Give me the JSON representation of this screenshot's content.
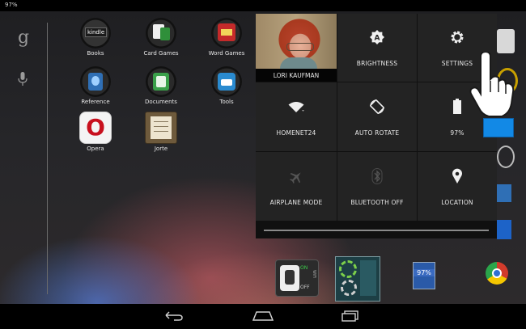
{
  "status_bar": {
    "battery": "97%"
  },
  "home": {
    "apps": [
      {
        "label": "Books",
        "icon": "books-icon"
      },
      {
        "label": "Card Games",
        "icon": "card-games-icon"
      },
      {
        "label": "Word Games",
        "icon": "word-games-icon"
      },
      {
        "label": "Reference",
        "icon": "reference-icon"
      },
      {
        "label": "Documents",
        "icon": "documents-icon"
      },
      {
        "label": "Tools",
        "icon": "tools-icon"
      },
      {
        "label": "Opera",
        "icon": "opera-icon"
      },
      {
        "label": "Jorte",
        "icon": "jorte-icon"
      }
    ],
    "tile_text": {
      "kindle": "kindle",
      "opera": "O",
      "dock_battery": "97%",
      "wifi_on": "ON",
      "wifi_off": "OFF",
      "wifi_side": "WiFi"
    }
  },
  "quick_settings": {
    "profile_name": "LORI KAUFMAN",
    "brightness": {
      "label": "BRIGHTNESS",
      "icon": "brightness-auto-icon",
      "glyph": "A"
    },
    "settings": {
      "label": "SETTINGS",
      "icon": "gear-icon"
    },
    "wifi": {
      "label": "HOMENET24",
      "icon": "wifi-icon"
    },
    "auto_rotate": {
      "label": "AUTO ROTATE",
      "icon": "auto-rotate-icon"
    },
    "battery": {
      "label": "97%",
      "icon": "battery-icon",
      "level": 97
    },
    "airplane": {
      "label": "AIRPLANE MODE",
      "icon": "airplane-icon"
    },
    "bluetooth": {
      "label": "BLUETOOTH OFF",
      "icon": "bluetooth-icon"
    },
    "location": {
      "label": "LOCATION",
      "icon": "location-pin-icon"
    }
  },
  "nav": {
    "back": "back-icon",
    "home": "home-icon",
    "recents": "recents-icon"
  },
  "colors": {
    "panel": "#232323",
    "accent_blue": "#1289e6",
    "opera_red": "#c8101e"
  }
}
